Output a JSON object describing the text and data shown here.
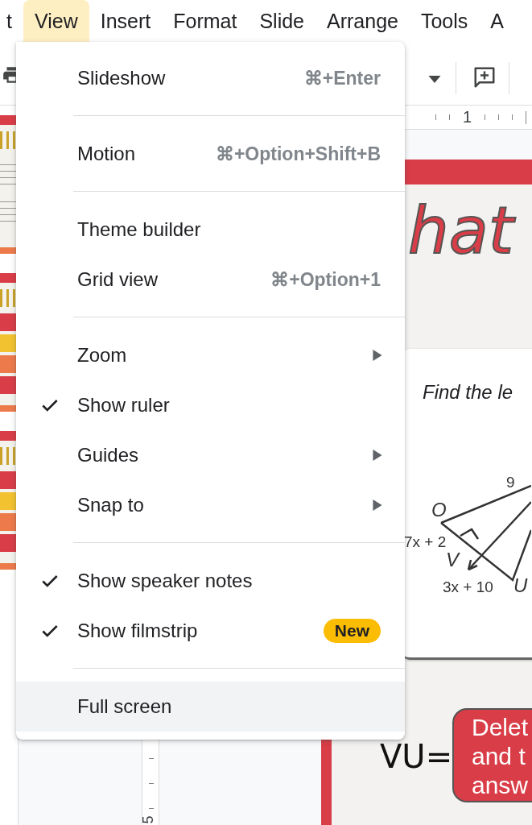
{
  "menu_bar": [
    {
      "label": "t",
      "selected": false
    },
    {
      "label": "View",
      "selected": true
    },
    {
      "label": "Insert",
      "selected": false
    },
    {
      "label": "Format",
      "selected": false
    },
    {
      "label": "Slide",
      "selected": false
    },
    {
      "label": "Arrange",
      "selected": false
    },
    {
      "label": "Tools",
      "selected": false
    },
    {
      "label": "A",
      "selected": false
    }
  ],
  "horizontal_ruler": {
    "label": "1"
  },
  "vertical_ruler": {
    "label": "5"
  },
  "view_menu": {
    "groups": [
      [
        {
          "label": "Slideshow",
          "shortcut": "⌘+Enter",
          "checked": false,
          "submenu": false,
          "hovered": false
        }
      ],
      [
        {
          "label": "Motion",
          "shortcut": "⌘+Option+Shift+B",
          "checked": false,
          "submenu": false,
          "hovered": false
        }
      ],
      [
        {
          "label": "Theme builder",
          "checked": false,
          "submenu": false,
          "hovered": false
        },
        {
          "label": "Grid view",
          "shortcut": "⌘+Option+1",
          "checked": false,
          "submenu": false,
          "hovered": false
        }
      ],
      [
        {
          "label": "Zoom",
          "checked": false,
          "submenu": true,
          "hovered": false
        },
        {
          "label": "Show ruler",
          "checked": true,
          "submenu": false,
          "hovered": false
        },
        {
          "label": "Guides",
          "checked": false,
          "submenu": true,
          "hovered": false
        },
        {
          "label": "Snap to",
          "checked": false,
          "submenu": true,
          "hovered": false
        }
      ],
      [
        {
          "label": "Show speaker notes",
          "checked": true,
          "submenu": false,
          "hovered": false
        },
        {
          "label": "Show filmstrip",
          "badge": "New",
          "checked": true,
          "submenu": false,
          "hovered": false
        }
      ],
      [
        {
          "label": "Full screen",
          "checked": false,
          "submenu": false,
          "hovered": true
        }
      ]
    ]
  },
  "slide": {
    "title": "hat",
    "question": "Find the le",
    "figure_labels": [
      "9",
      "O",
      "7x + 2",
      "V",
      "3x + 10",
      "U"
    ],
    "answer_label": "VU=",
    "answer_box": [
      "Delet",
      "and t",
      "answ"
    ]
  }
}
